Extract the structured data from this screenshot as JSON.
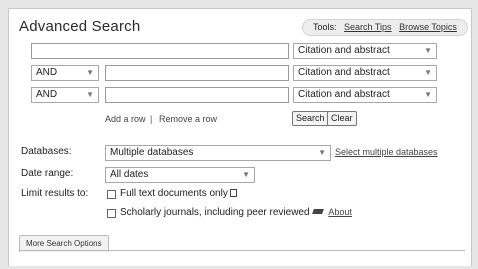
{
  "header": {
    "title": "Advanced Search",
    "tools_label": "Tools:",
    "search_tips": "Search Tips",
    "browse_topics": "Browse Topics"
  },
  "rows": [
    {
      "operator": "",
      "field": "Citation and abstract"
    },
    {
      "operator": "AND",
      "field": "Citation and abstract"
    },
    {
      "operator": "AND",
      "field": "Citation and abstract"
    }
  ],
  "row_actions": {
    "add_row": "Add a row",
    "separator": "|",
    "remove_row": "Remove a row",
    "search": "Search",
    "clear": "Clear"
  },
  "filters": {
    "databases_label": "Databases:",
    "databases_value": "Multiple databases",
    "select_databases": "Select multiple databases",
    "date_label": "Date range:",
    "date_value": "All dates",
    "limit_label": "Limit results to:",
    "full_text": "Full text documents only",
    "scholarly": "Scholarly journals, including peer reviewed",
    "about": "About"
  },
  "more_tab": "More Search Options",
  "icons": {
    "dropdown": "chevron-down-icon",
    "document": "document-icon",
    "pencil": "pencil-icon"
  }
}
